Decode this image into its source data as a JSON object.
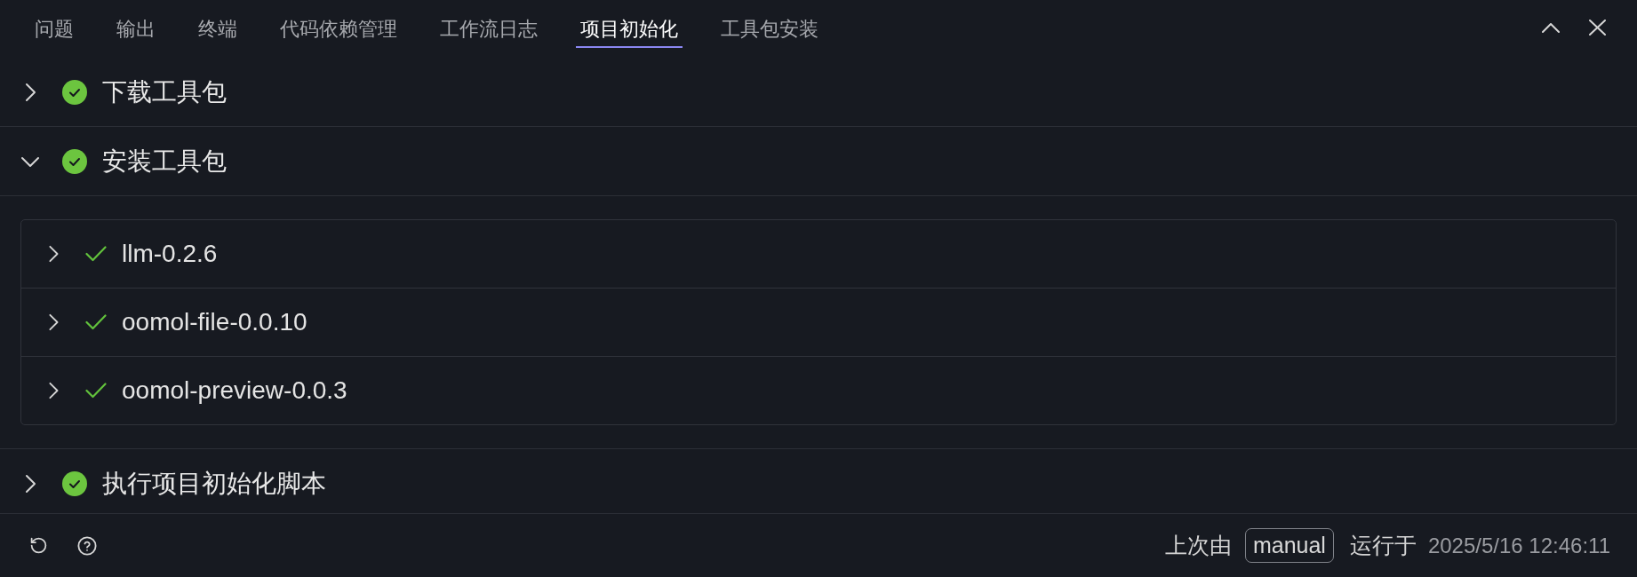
{
  "tabs": [
    {
      "label": "问题",
      "selected": false
    },
    {
      "label": "输出",
      "selected": false
    },
    {
      "label": "终端",
      "selected": false
    },
    {
      "label": "代码依赖管理",
      "selected": false
    },
    {
      "label": "工作流日志",
      "selected": false
    },
    {
      "label": "项目初始化",
      "selected": true
    },
    {
      "label": "工具包安装",
      "selected": false
    }
  ],
  "sections": [
    {
      "title": "下载工具包",
      "completed": true,
      "expanded": false
    },
    {
      "title": "安装工具包",
      "completed": true,
      "expanded": true,
      "children": [
        {
          "name": "llm-0.2.6",
          "completed": true,
          "expanded": false
        },
        {
          "name": "oomol-file-0.0.10",
          "completed": true,
          "expanded": false
        },
        {
          "name": "oomol-preview-0.0.3",
          "completed": true,
          "expanded": false
        }
      ]
    },
    {
      "title": "执行项目初始化脚本",
      "completed": true,
      "expanded": false
    }
  ],
  "footer": {
    "prefix": "上次由",
    "trigger": "manual",
    "middle": "运行于",
    "timestamp": "2025/5/16 12:46:11"
  }
}
